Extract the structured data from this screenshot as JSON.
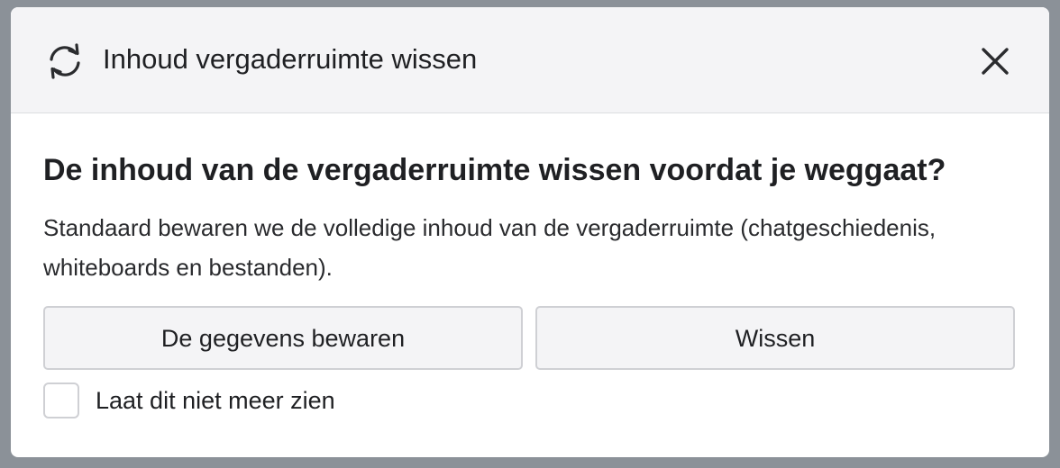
{
  "dialog": {
    "header": {
      "icon": "refresh-icon",
      "title": "Inhoud vergaderruimte wissen",
      "close_icon": "close-icon"
    },
    "heading": "De inhoud van de vergaderruimte wissen voordat je weggaat?",
    "description": "Standaard bewaren we de volledige inhoud van de vergaderruimte (chatgeschiedenis, whiteboards en bestanden).",
    "buttons": {
      "keep_label": "De gegevens bewaren",
      "clear_label": "Wissen"
    },
    "checkbox": {
      "label": "Laat dit niet meer zien",
      "checked": false
    }
  },
  "colors": {
    "header_background": "#f4f4f6",
    "button_background": "#f4f4f6",
    "border": "#cfd0d4",
    "text": "#1f2023",
    "overlay": "#8b9198"
  }
}
